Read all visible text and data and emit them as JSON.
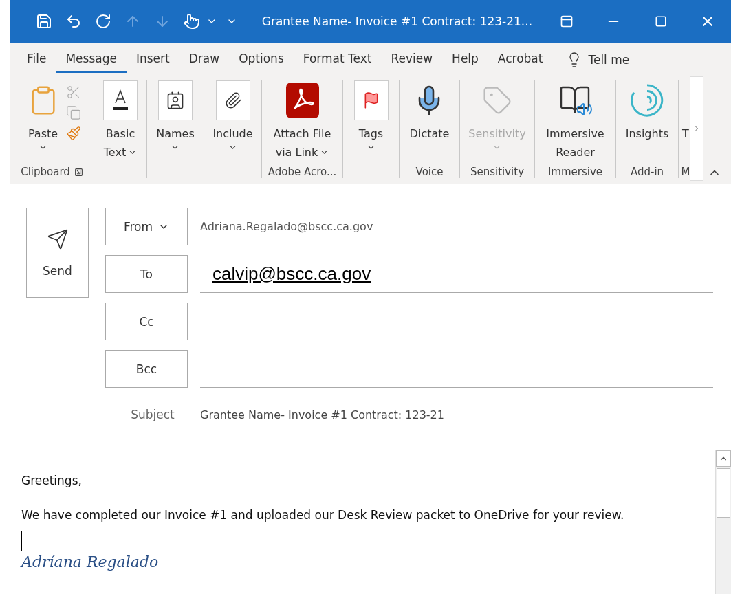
{
  "window": {
    "title": "Grantee Name- Invoice #1 Contract: 123-21..."
  },
  "menu_tabs": [
    {
      "label": "File",
      "selected": false
    },
    {
      "label": "Message",
      "selected": true
    },
    {
      "label": "Insert",
      "selected": false
    },
    {
      "label": "Draw",
      "selected": false
    },
    {
      "label": "Options",
      "selected": false
    },
    {
      "label": "Format Text",
      "selected": false
    },
    {
      "label": "Review",
      "selected": false
    },
    {
      "label": "Help",
      "selected": false
    },
    {
      "label": "Acrobat",
      "selected": false
    }
  ],
  "tell_me": "Tell me",
  "ribbon_groups": [
    {
      "label": "Clipboard",
      "launcher": true,
      "buttons": [
        {
          "lines": [
            "Paste"
          ],
          "dropdown": true,
          "disabled": false
        }
      ]
    },
    {
      "buttons": [
        {
          "lines": [
            "Basic",
            "Text"
          ],
          "dropdown": true,
          "disabled": false
        }
      ]
    },
    {
      "buttons": [
        {
          "lines": [
            "Names"
          ],
          "dropdown": true,
          "disabled": false
        }
      ]
    },
    {
      "buttons": [
        {
          "lines": [
            "Include"
          ],
          "dropdown": true,
          "disabled": false
        }
      ]
    },
    {
      "label": "Adobe Acro...",
      "buttons": [
        {
          "lines": [
            "Attach File",
            "via Link"
          ],
          "dropdown": true,
          "disabled": false
        }
      ]
    },
    {
      "buttons": [
        {
          "lines": [
            "Tags"
          ],
          "dropdown": true,
          "disabled": false
        }
      ]
    },
    {
      "label": "Voice",
      "buttons": [
        {
          "lines": [
            "Dictate"
          ],
          "dropdown": false,
          "disabled": false
        }
      ]
    },
    {
      "label": "Sensitivity",
      "buttons": [
        {
          "lines": [
            "Sensitivity"
          ],
          "dropdown": true,
          "disabled": true
        }
      ]
    },
    {
      "label": "Immersive",
      "buttons": [
        {
          "lines": [
            "Immersive",
            "Reader"
          ],
          "dropdown": false,
          "disabled": false
        }
      ]
    },
    {
      "label": "Add-in",
      "buttons": [
        {
          "lines": [
            "Insights"
          ],
          "dropdown": false,
          "disabled": false
        }
      ]
    },
    {
      "label": "M",
      "buttons": [
        {
          "lines": [
            "T"
          ],
          "dropdown": false,
          "disabled": false
        }
      ]
    }
  ],
  "send_button": "Send",
  "fields": [
    {
      "label": "From",
      "dropdown": true,
      "value": "Adriana.Regalado@bscc.ca.gov",
      "kind": "plain"
    },
    {
      "label": "To",
      "dropdown": false,
      "value": "calvip@bscc.ca.gov",
      "kind": "link"
    },
    {
      "label": "Cc",
      "dropdown": false
    },
    {
      "label": "Bcc",
      "dropdown": false
    }
  ],
  "subject": {
    "label": "Subject",
    "value": "Grantee Name- Invoice #1 Contract: 123-21"
  },
  "body": {
    "paragraphs": [
      "Greetings,",
      "We have completed our Invoice #1 and uploaded our Desk Review packet to OneDrive for your review."
    ],
    "signature": "Adríana Regalado"
  }
}
